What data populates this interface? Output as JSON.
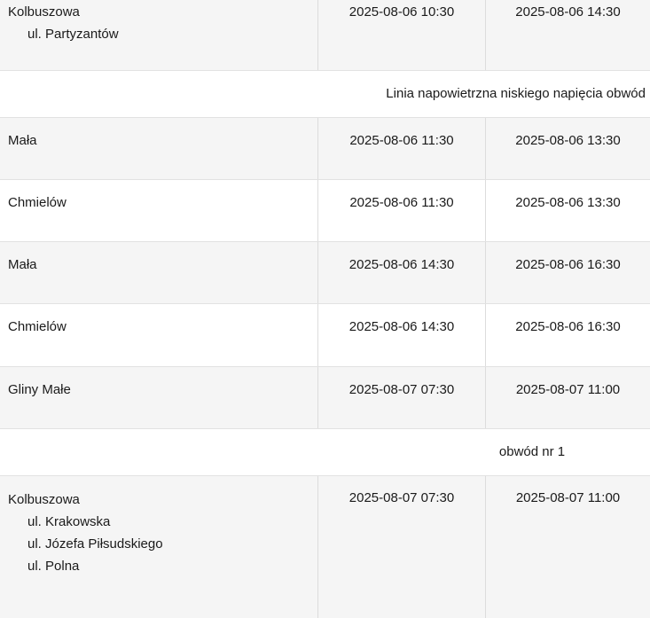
{
  "rows": [
    {
      "locality": "Kolbuszowa",
      "streets": [
        "ul. Partyzantów"
      ],
      "start": "2025-08-06 10:30",
      "end": "2025-08-06 14:30"
    },
    {
      "header": "Linia napowietrzna niskiego napięcia obwód"
    },
    {
      "locality": "Mała",
      "start": "2025-08-06 11:30",
      "end": "2025-08-06 13:30"
    },
    {
      "locality": "Chmielów",
      "start": "2025-08-06 11:30",
      "end": "2025-08-06 13:30"
    },
    {
      "locality": "Mała",
      "start": "2025-08-06 14:30",
      "end": "2025-08-06 16:30"
    },
    {
      "locality": "Chmielów",
      "start": "2025-08-06 14:30",
      "end": "2025-08-06 16:30"
    },
    {
      "locality": "Gliny Małe",
      "start": "2025-08-07 07:30",
      "end": "2025-08-07 11:00"
    },
    {
      "header": "obwód nr 1"
    },
    {
      "locality": "Kolbuszowa",
      "streets": [
        "ul. Krakowska",
        "ul. Józefa Piłsudskiego",
        "ul. Polna"
      ],
      "start": "2025-08-07 07:30",
      "end": "2025-08-07 11:00"
    }
  ]
}
